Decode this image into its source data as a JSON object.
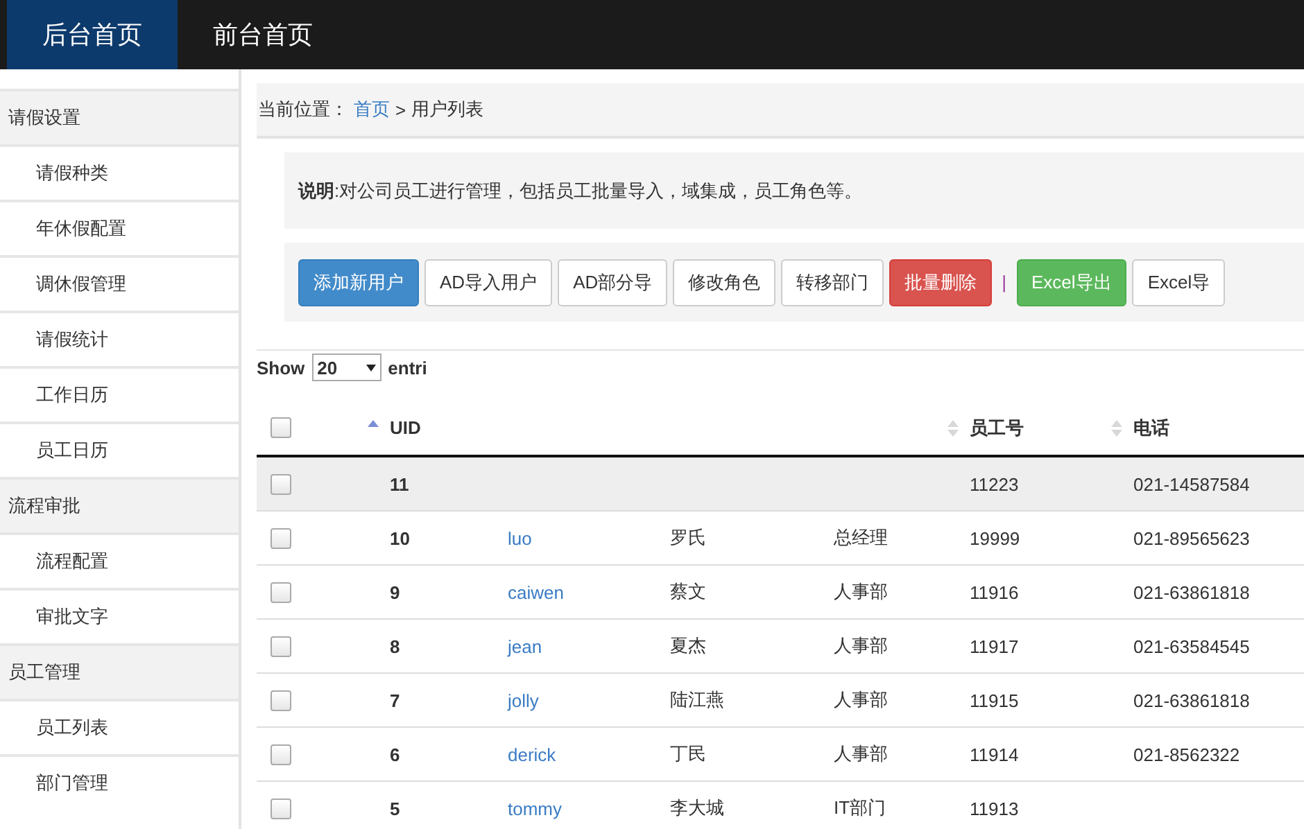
{
  "top_nav": [
    {
      "label": "后台首页",
      "selected": true
    },
    {
      "label": "前台首页",
      "selected": false
    }
  ],
  "sidebar": {
    "groups": [
      {
        "title": "请假设置",
        "items": [
          {
            "label": "请假种类"
          },
          {
            "label": "年休假配置"
          },
          {
            "label": "调休假管理"
          },
          {
            "label": "请假统计"
          },
          {
            "label": "工作日历"
          },
          {
            "label": "员工日历"
          }
        ]
      },
      {
        "title": "流程审批",
        "items": [
          {
            "label": "流程配置"
          },
          {
            "label": "审批文字"
          }
        ]
      },
      {
        "title": "员工管理",
        "items": [
          {
            "label": "员工列表"
          },
          {
            "label": "部门管理"
          }
        ]
      }
    ]
  },
  "breadcrumb": {
    "prefix": "当前位置：",
    "home": "首页",
    "separator": ">",
    "current": "用户列表"
  },
  "description": {
    "label": "说明",
    "text": ":对公司员工进行管理，包括员工批量导入，域集成，员工角色等。"
  },
  "toolbar": [
    {
      "kind": "primary",
      "label": "添加新用户"
    },
    {
      "kind": "default",
      "label": "AD导入用户"
    },
    {
      "kind": "default",
      "label": "AD部分导"
    },
    {
      "kind": "default",
      "label": "修改角色"
    },
    {
      "kind": "default",
      "label": "转移部门"
    },
    {
      "kind": "danger",
      "label": "批量删除"
    },
    {
      "kind": "separator",
      "label": "|"
    },
    {
      "kind": "success",
      "label": "Excel导出"
    },
    {
      "kind": "default",
      "label": "Excel导"
    }
  ],
  "page_length": {
    "label": "Show",
    "value": "20",
    "suffix": "entri"
  },
  "table": {
    "columns": [
      {
        "kind": "checkbox",
        "checked": false,
        "sorted": true
      },
      {
        "label": "UID"
      },
      {},
      {},
      {
        "sorted": false
      },
      {
        "label": "员工号",
        "sorted": false
      },
      {
        "label": "电话"
      }
    ],
    "rows": [
      {
        "checked": false,
        "highlighted": true,
        "uid": "11",
        "emp_no": "11223",
        "phone": "021-14587584"
      },
      {
        "checked": false,
        "highlighted": false,
        "uid": "10",
        "username": "luo",
        "name": "罗氏",
        "department": "总经理",
        "emp_no": "19999",
        "phone": "021-89565623"
      },
      {
        "checked": false,
        "highlighted": false,
        "uid": "9",
        "username": "caiwen",
        "name": "蔡文",
        "department": "人事部",
        "emp_no": "11916",
        "phone": "021-63861818"
      },
      {
        "checked": false,
        "highlighted": false,
        "uid": "8",
        "username": "jean",
        "name": "夏杰",
        "department": "人事部",
        "emp_no": "11917",
        "phone": "021-63584545"
      },
      {
        "checked": false,
        "highlighted": false,
        "uid": "7",
        "username": "jolly",
        "name": "陆江燕",
        "department": "人事部",
        "emp_no": "11915",
        "phone": "021-63861818"
      },
      {
        "checked": false,
        "highlighted": false,
        "uid": "6",
        "username": "derick",
        "name": "丁民",
        "department": "人事部",
        "emp_no": "11914",
        "phone": "021-8562322"
      },
      {
        "checked": false,
        "highlighted": false,
        "uid": "5",
        "username": "tommy",
        "name": "李大城",
        "department": "IT部门",
        "emp_no": "11913"
      }
    ]
  }
}
